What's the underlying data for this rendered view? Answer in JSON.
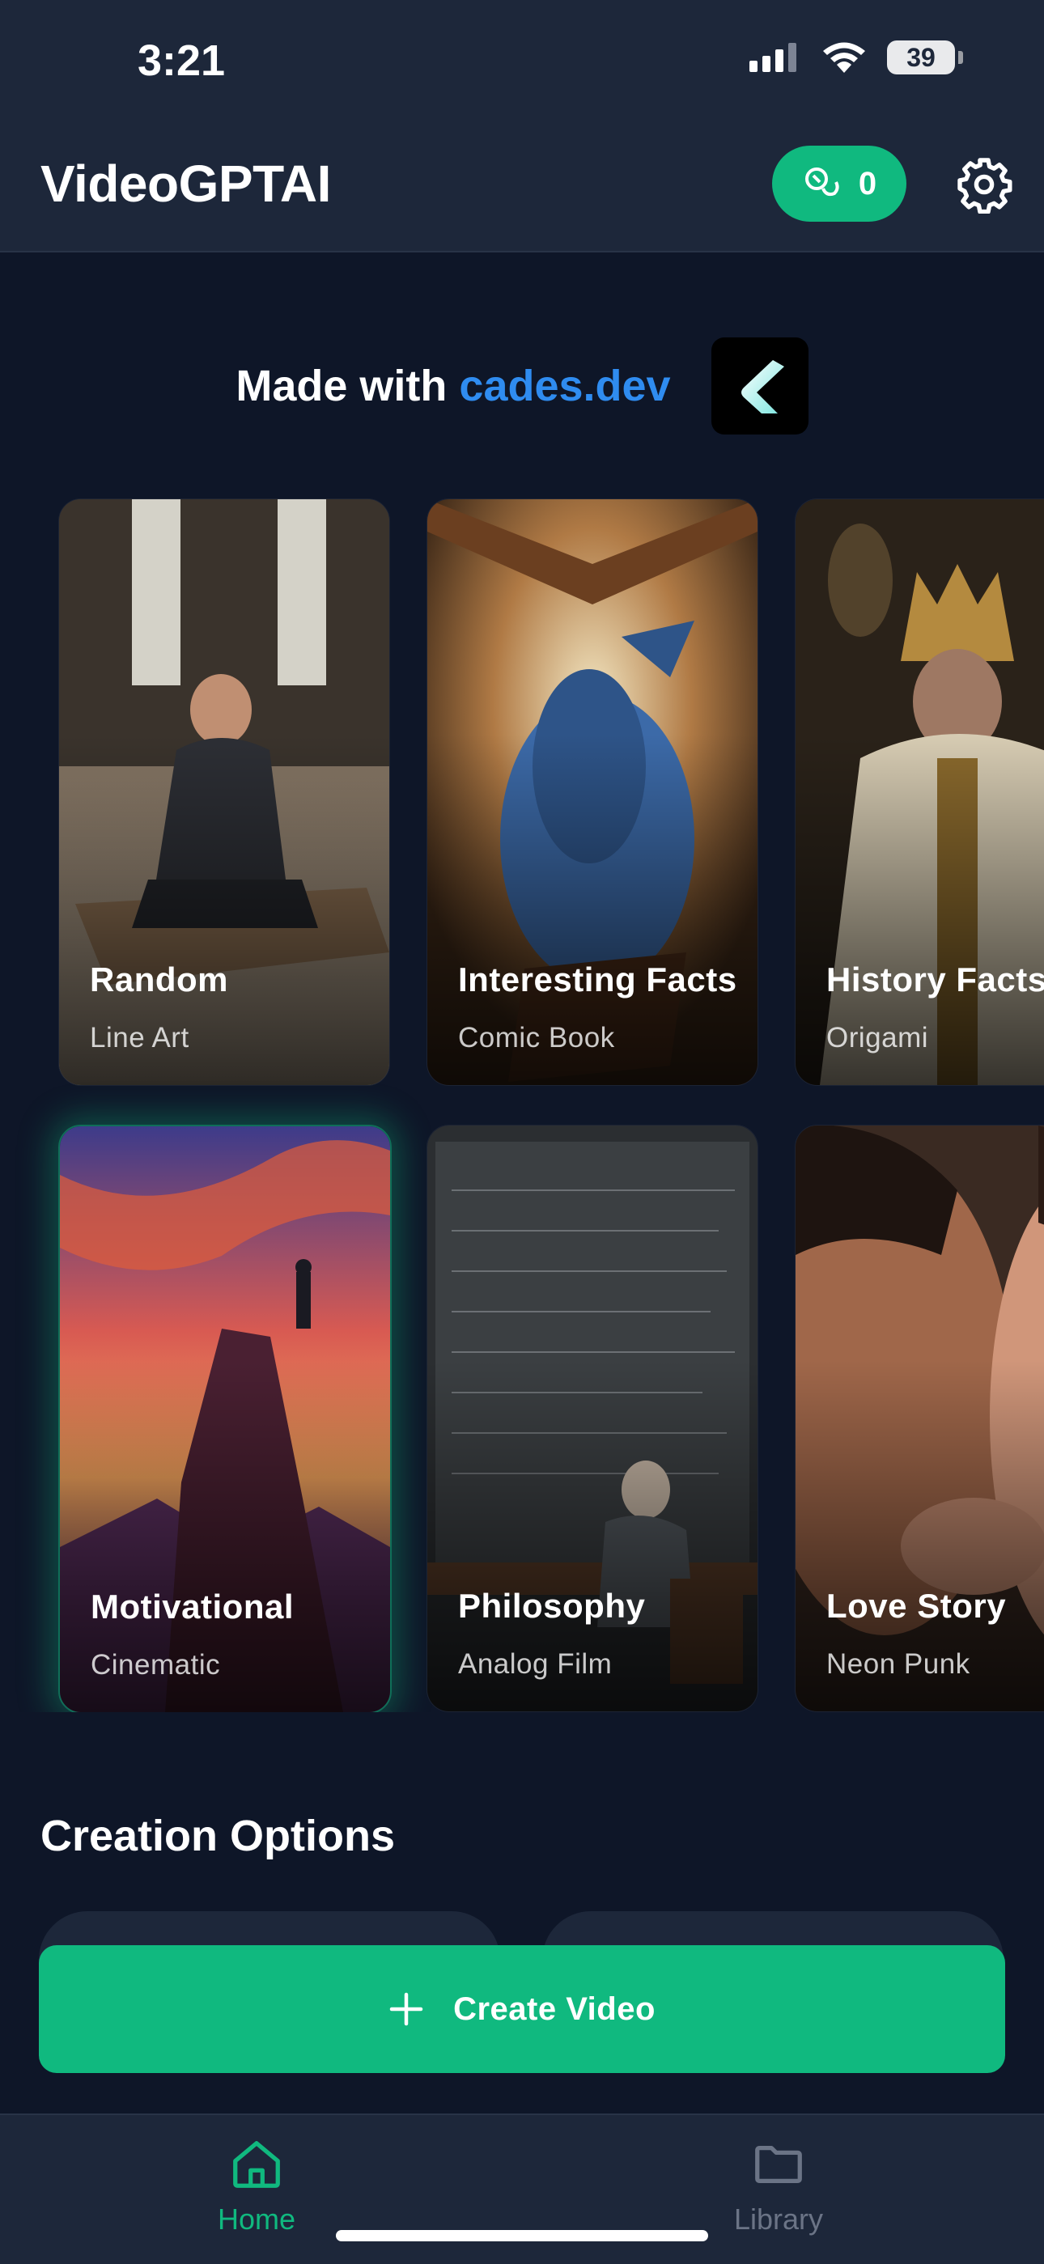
{
  "status_bar": {
    "time": "3:21",
    "battery": "39"
  },
  "header": {
    "title": "VideoGPTAI",
    "credits": "0"
  },
  "promo": {
    "prefix": "Made with",
    "link": "cades.dev"
  },
  "cards": [
    {
      "title": "Random",
      "style": "Line Art"
    },
    {
      "title": "Interesting Facts",
      "style": "Comic Book"
    },
    {
      "title": "History Facts",
      "style": "Origami"
    },
    {
      "title": "Motivational",
      "style": "Cinematic"
    },
    {
      "title": "Philosophy",
      "style": "Analog Film"
    },
    {
      "title": "Love Story",
      "style": "Neon Punk"
    }
  ],
  "section": {
    "title": "Creation Options"
  },
  "create_button": {
    "label": "Create Video"
  },
  "nav": {
    "home": "Home",
    "library": "Library"
  },
  "colors": {
    "accent": "#10b97f",
    "link": "#2f8cf0",
    "background": "#0e1628",
    "bar": "#1d273a"
  },
  "icons": [
    "signal-icon",
    "wifi-icon",
    "battery-icon",
    "coins-icon",
    "gear-icon",
    "cades-logo",
    "plus-icon",
    "home-icon",
    "folder-icon"
  ]
}
